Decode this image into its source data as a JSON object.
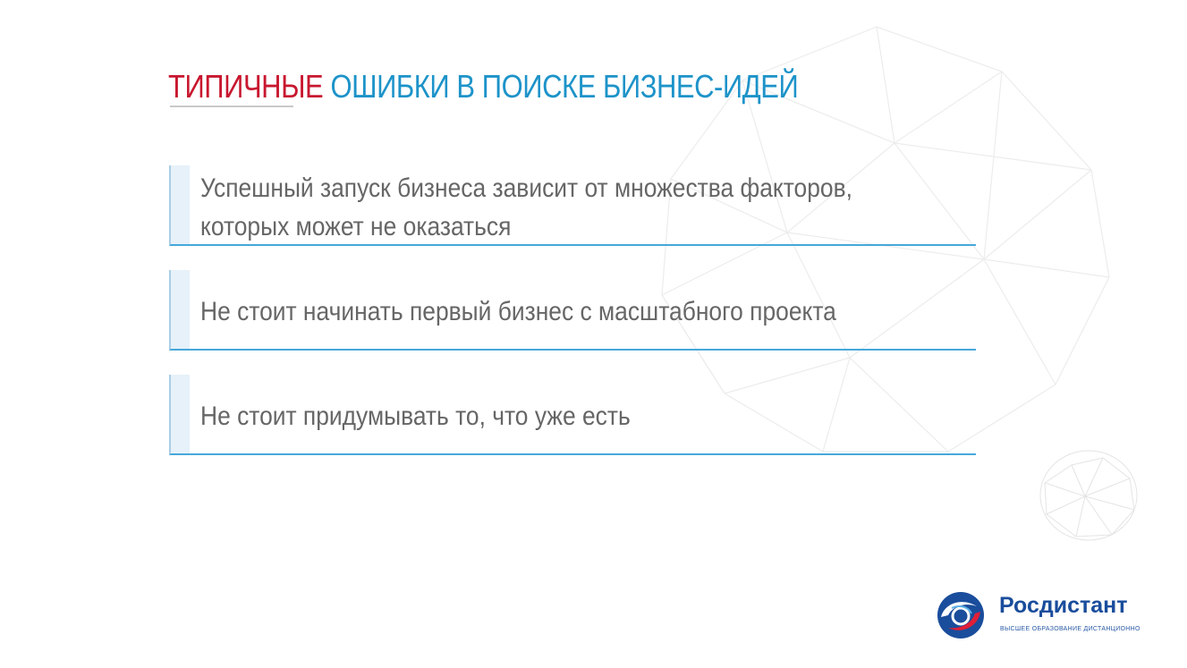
{
  "title": {
    "accent": "ТИПИЧНЫЕ",
    "main": "ОШИБКИ В ПОИСКЕ БИЗНЕС-ИДЕЙ"
  },
  "items": [
    {
      "line1": "Успешный запуск бизнеса зависит от множества факторов,",
      "line2": "которых может не оказаться"
    },
    {
      "line1": "Не стоит начинать первый бизнес с масштабного проекта"
    },
    {
      "line1": "Не стоит придумывать то, что уже есть"
    }
  ],
  "logo": {
    "name": "Росдистант",
    "tagline": "ВЫСШЕЕ ОБРАЗОВАНИЕ ДИСТАНЦИОННО"
  },
  "colors": {
    "accent_red": "#c8172f",
    "title_blue": "#1d93c9",
    "line_blue": "#46a8da",
    "text_gray": "#666666"
  },
  "icons": [
    "globe-decoration",
    "rosdistant-logo-icon"
  ]
}
